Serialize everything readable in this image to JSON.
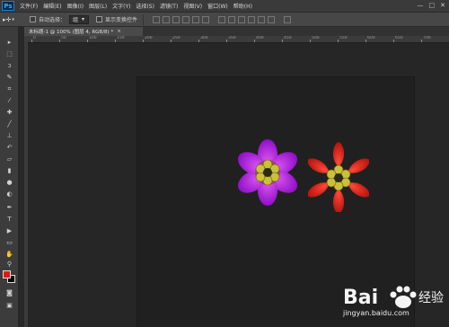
{
  "app": {
    "logo": "Ps"
  },
  "menu": [
    "文件(F)",
    "编辑(E)",
    "图像(I)",
    "图层(L)",
    "文字(Y)",
    "选择(S)",
    "滤镜(T)",
    "视图(V)",
    "窗口(W)",
    "帮助(H)"
  ],
  "window_controls": [
    "—",
    "□",
    "✕"
  ],
  "options": {
    "auto_select_label": "自动选择：",
    "auto_select_value": "组",
    "show_transform_label": "显示变换控件"
  },
  "document": {
    "tab_title": "未标题-1 @ 100% (图层 4, RGB/8) *",
    "close": "×"
  },
  "ruler_numbers": [
    "0",
    "50",
    "100",
    "150",
    "200",
    "250",
    "300",
    "350",
    "400",
    "450",
    "500",
    "550",
    "600",
    "650",
    "700"
  ],
  "toolbar_icons": [
    "move-icon",
    "marquee-icon",
    "lasso-icon",
    "quick-select-icon",
    "crop-icon",
    "eyedropper-icon",
    "healing-icon",
    "brush-icon",
    "stamp-icon",
    "history-brush-icon",
    "eraser-icon",
    "gradient-icon",
    "blur-icon",
    "dodge-icon",
    "pen-icon",
    "type-icon",
    "path-select-icon",
    "shape-icon",
    "hand-icon",
    "zoom-icon"
  ],
  "colors": {
    "foreground": "#e01818",
    "background": "#000000",
    "flower1_petal": "#b421e6",
    "flower2_petal": "#e0241a",
    "flower_center": "#c9c13a"
  },
  "watermark": {
    "brand": "Bai 经验",
    "url": "jingyan.baidu.com"
  }
}
